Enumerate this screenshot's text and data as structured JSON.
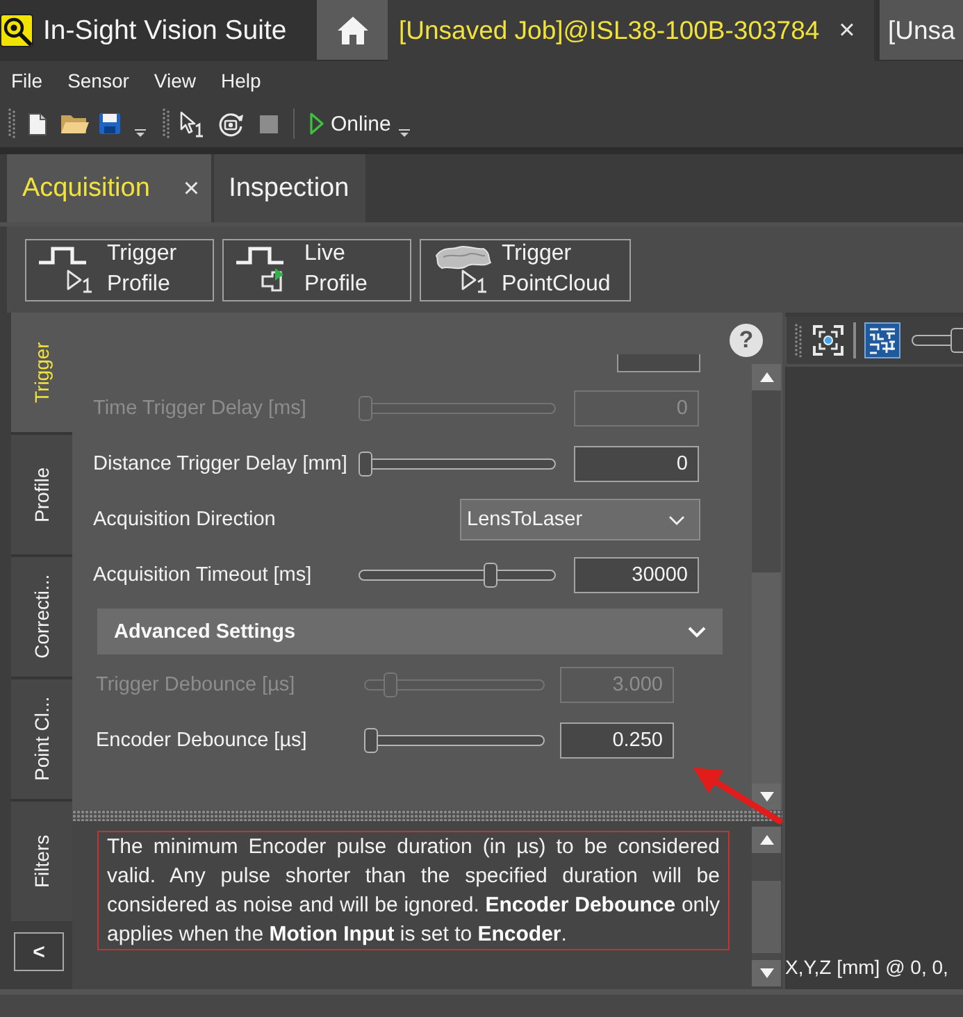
{
  "window": {
    "title": "In-Sight Vision Suite"
  },
  "doc_tabs": [
    {
      "kind": "home",
      "selected": false
    },
    {
      "kind": "document",
      "label": "[Unsaved Job]@ISL38-100B-303784",
      "close": "×",
      "selected": true
    },
    {
      "kind": "document",
      "label": "[Unsa",
      "selected": false
    }
  ],
  "menu": [
    "File",
    "Sensor",
    "View",
    "Help"
  ],
  "toolbar": {
    "online_button": "Online"
  },
  "panel_tabs": [
    {
      "label": "Acquisition",
      "close": "×",
      "selected": true
    },
    {
      "label": "Inspection",
      "selected": false
    }
  ],
  "actions": [
    {
      "kind": "trigger",
      "label": "Trigger Profile"
    },
    {
      "kind": "live",
      "label": "Live Profile"
    },
    {
      "kind": "pointcloud",
      "label": "Trigger PointCloud"
    }
  ],
  "side_tabs": [
    {
      "label": "Trigger",
      "selected": true
    },
    {
      "label": "Profile",
      "selected": false
    },
    {
      "label": "Correcti...",
      "selected": false
    },
    {
      "label": "Point Cl...",
      "selected": false
    },
    {
      "label": "Filters",
      "selected": false
    }
  ],
  "collapse_button": "<",
  "help_button": "?",
  "settings": [
    {
      "kind": "slider",
      "label": "Time Trigger Delay [ms]",
      "disabled": true,
      "level": 0,
      "value": "0"
    },
    {
      "kind": "slider",
      "label": "Distance Trigger Delay [mm]",
      "disabled": false,
      "level": 0,
      "value": "0"
    },
    {
      "kind": "dropdown",
      "label": "Acquisition Direction",
      "disabled": false,
      "value": "LensToLaser"
    },
    {
      "kind": "slider",
      "label": "Acquisition Timeout [ms]",
      "disabled": false,
      "level": 0.68,
      "value": "30000"
    }
  ],
  "advanced": {
    "title": "Advanced Settings",
    "expanded": true,
    "settings": [
      {
        "kind": "slider",
        "label": "Trigger Debounce [µs]",
        "disabled": true,
        "level": 0.12,
        "value": "3.000"
      },
      {
        "kind": "slider",
        "label": "Encoder Debounce [µs]",
        "disabled": false,
        "level": 0,
        "value": "0.250"
      }
    ]
  },
  "description": "The minimum Encoder pulse duration (in µs) to be considered valid. Any pulse shorter than the specified duration will be considered as noise and will be ignored. **Encoder Debounce** only applies when the **Motion Input** is set to **Encoder**.",
  "viewer": {
    "tools": [
      {
        "kind": "target",
        "selected": false
      },
      {
        "kind": "grid",
        "selected": true
      }
    ],
    "zoom": {
      "level": 1
    },
    "coordinates": "X,Y,Z [mm] @ 0, 0,"
  }
}
